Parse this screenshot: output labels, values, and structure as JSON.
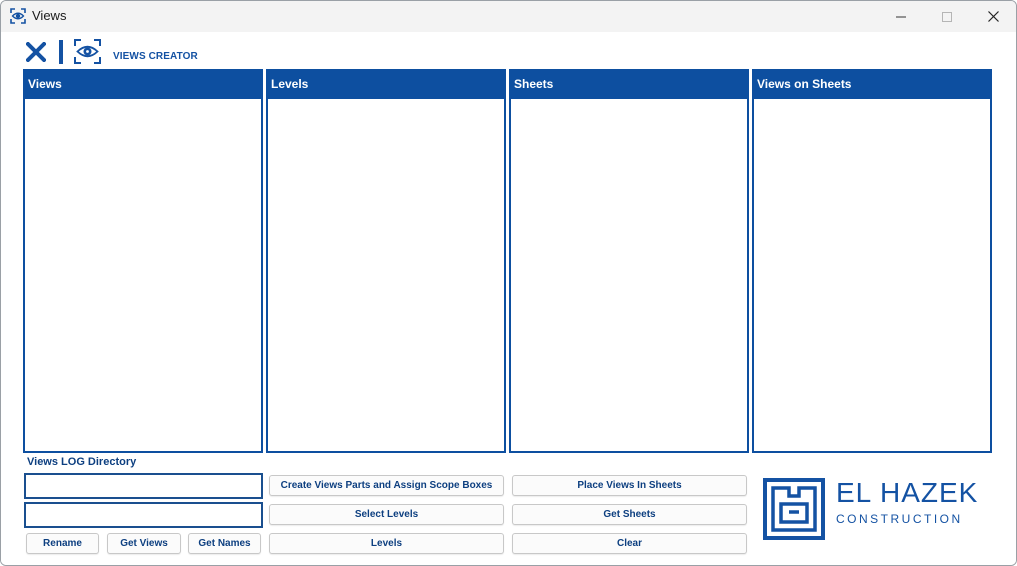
{
  "window": {
    "title": "Views"
  },
  "toolbar": {
    "app_title": "VIEWS CREATOR"
  },
  "panels": [
    {
      "title": "Views"
    },
    {
      "title": "Levels"
    },
    {
      "title": "Sheets"
    },
    {
      "title": "Views on Sheets"
    }
  ],
  "log": {
    "label": "Views LOG Directory"
  },
  "buttons": {
    "rename": "Rename",
    "get_views": "Get Views",
    "get_names": "Get Names",
    "create_parts": "Create Views Parts and Assign Scope Boxes",
    "select_levels": "Select Levels",
    "levels": "Levels",
    "place_views": "Place Views In Sheets",
    "get_sheets": "Get Sheets",
    "clear": "Clear"
  },
  "logo": {
    "name": "EL HAZEK",
    "subtitle": "CONSTRUCTION"
  },
  "colors": {
    "accent": "#0d4fa0",
    "text_dark_blue": "#0d3f80"
  },
  "icons": [
    "app-eye-icon",
    "close-icon",
    "eye-icon",
    "minimize-icon",
    "maximize-icon",
    "window-close-icon"
  ]
}
